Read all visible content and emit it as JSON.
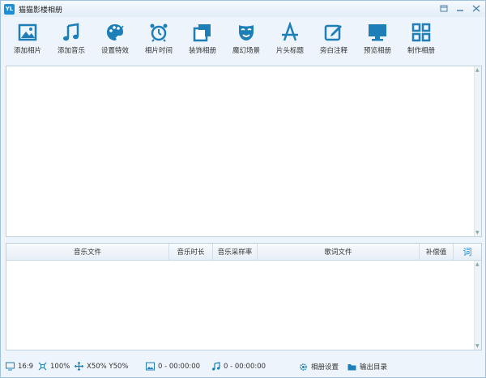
{
  "window": {
    "logo": "YL",
    "title": "猫猫影楼相册"
  },
  "toolbar": [
    {
      "icon": "picture-icon",
      "label": "添加相片"
    },
    {
      "icon": "music-note-icon",
      "label": "添加音乐"
    },
    {
      "icon": "palette-icon",
      "label": "设置特效"
    },
    {
      "icon": "alarm-clock-icon",
      "label": "相片时间"
    },
    {
      "icon": "frame-icon",
      "label": "装饰相册"
    },
    {
      "icon": "mask-icon",
      "label": "魔幻场景"
    },
    {
      "icon": "title-a-icon",
      "label": "片头标题"
    },
    {
      "icon": "edit-icon",
      "label": "旁白注释"
    },
    {
      "icon": "monitor-icon",
      "label": "预览相册"
    },
    {
      "icon": "grid-icon",
      "label": "制作相册"
    }
  ],
  "music_table": {
    "columns": [
      "音乐文件",
      "音乐时长",
      "音乐采样率",
      "歌词文件",
      "补偿值",
      "词"
    ]
  },
  "status": {
    "aspect": "16:9",
    "zoom": "100%",
    "position": "X50% Y50%",
    "photo_time": "0 - 00:00:00",
    "music_time": "0 - 00:00:00",
    "album_settings": "相册设置",
    "output_dir": "输出目录"
  },
  "colors": {
    "accent": "#1b8ed8",
    "icon": "#1e7fb8"
  }
}
